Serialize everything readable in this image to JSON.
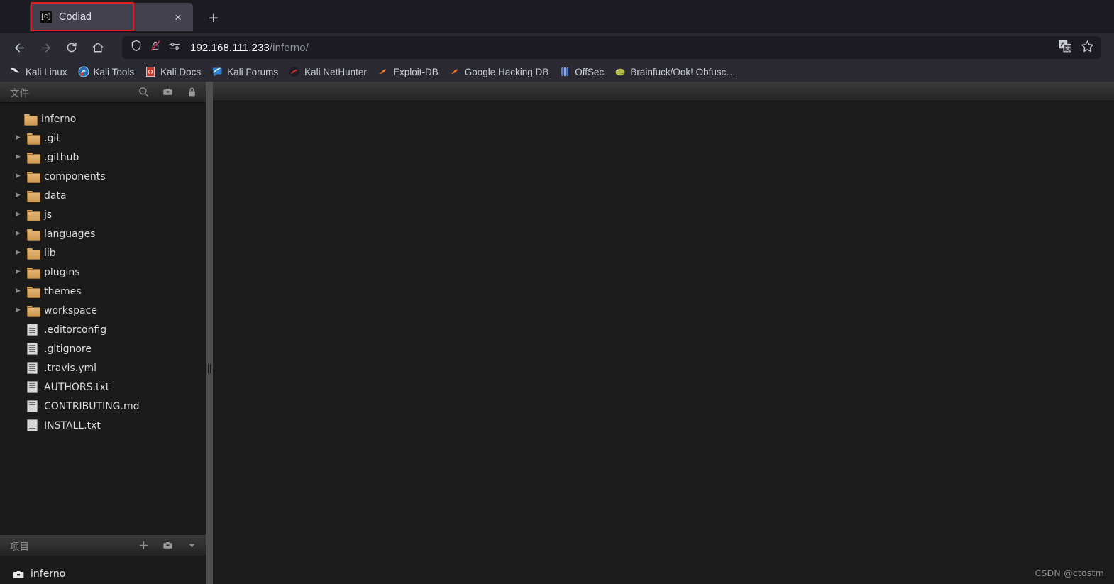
{
  "browser": {
    "tab": {
      "title": "Codiad",
      "favicon_text": "[C]",
      "favicon_name": "codiad-favicon",
      "close_label": "×"
    },
    "new_tab_label": "+",
    "nav": {
      "back": "back-arrow",
      "forward": "forward-arrow",
      "reload": "reload-icon",
      "home": "home-icon"
    },
    "urlbar": {
      "shield_icon": "tracking-protection-shield",
      "lock_icon": "insecure-connection-lock",
      "permissions_icon": "site-permissions-icon",
      "host": "192.168.111.233",
      "path": "/inferno/",
      "translate_icon": "translate-icon",
      "bookmark_icon": "bookmark-star-icon"
    },
    "bookmarks": [
      {
        "label": "Kali Linux",
        "icon": "kali-dragon-icon"
      },
      {
        "label": "Kali Tools",
        "icon": "kali-tools-icon"
      },
      {
        "label": "Kali Docs",
        "icon": "kali-docs-icon"
      },
      {
        "label": "Kali Forums",
        "icon": "kali-forums-icon"
      },
      {
        "label": "Kali NetHunter",
        "icon": "kali-nethunter-icon"
      },
      {
        "label": "Exploit-DB",
        "icon": "exploit-db-icon"
      },
      {
        "label": "Google Hacking DB",
        "icon": "google-hacking-db-icon"
      },
      {
        "label": "OffSec",
        "icon": "offsec-icon"
      },
      {
        "label": "Brainfuck/Ook! Obfusc…",
        "icon": "brainfuck-icon"
      }
    ]
  },
  "codiad": {
    "files_panel": {
      "title": "文件",
      "icons": [
        "search-icon",
        "archive-icon",
        "lock-icon"
      ],
      "tree": [
        {
          "label": "inferno",
          "type": "folder",
          "depth": 0,
          "expandable": false
        },
        {
          "label": ".git",
          "type": "folder",
          "depth": 1,
          "expandable": true
        },
        {
          "label": ".github",
          "type": "folder",
          "depth": 1,
          "expandable": true
        },
        {
          "label": "components",
          "type": "folder",
          "depth": 1,
          "expandable": true
        },
        {
          "label": "data",
          "type": "folder",
          "depth": 1,
          "expandable": true
        },
        {
          "label": "js",
          "type": "folder",
          "depth": 1,
          "expandable": true
        },
        {
          "label": "languages",
          "type": "folder",
          "depth": 1,
          "expandable": true
        },
        {
          "label": "lib",
          "type": "folder",
          "depth": 1,
          "expandable": true
        },
        {
          "label": "plugins",
          "type": "folder",
          "depth": 1,
          "expandable": true
        },
        {
          "label": "themes",
          "type": "folder",
          "depth": 1,
          "expandable": true
        },
        {
          "label": "workspace",
          "type": "folder",
          "depth": 1,
          "expandable": true
        },
        {
          "label": ".editorconfig",
          "type": "file",
          "depth": 1,
          "expandable": false
        },
        {
          "label": ".gitignore",
          "type": "file",
          "depth": 1,
          "expandable": false
        },
        {
          "label": ".travis.yml",
          "type": "file",
          "depth": 1,
          "expandable": false
        },
        {
          "label": "AUTHORS.txt",
          "type": "file",
          "depth": 1,
          "expandable": false
        },
        {
          "label": "CONTRIBUTING.md",
          "type": "file",
          "depth": 1,
          "expandable": false
        },
        {
          "label": "INSTALL.txt",
          "type": "file",
          "depth": 1,
          "expandable": false
        }
      ]
    },
    "projects_panel": {
      "title": "项目",
      "icons": [
        "add-icon",
        "archive-icon",
        "chevron-down-icon"
      ],
      "projects": [
        {
          "label": "inferno",
          "icon": "briefcase-icon"
        }
      ]
    }
  },
  "watermark": "CSDN @ctostm",
  "colors": {
    "chrome_bg": "#1c1b22",
    "toolbar_bg": "#2b2a33",
    "tab_active": "#42414d",
    "annotation_red": "#e02020",
    "folder_orange": "#d9a864",
    "page_bg": "#1c1c1c",
    "splitter": "#4e4e4e"
  }
}
